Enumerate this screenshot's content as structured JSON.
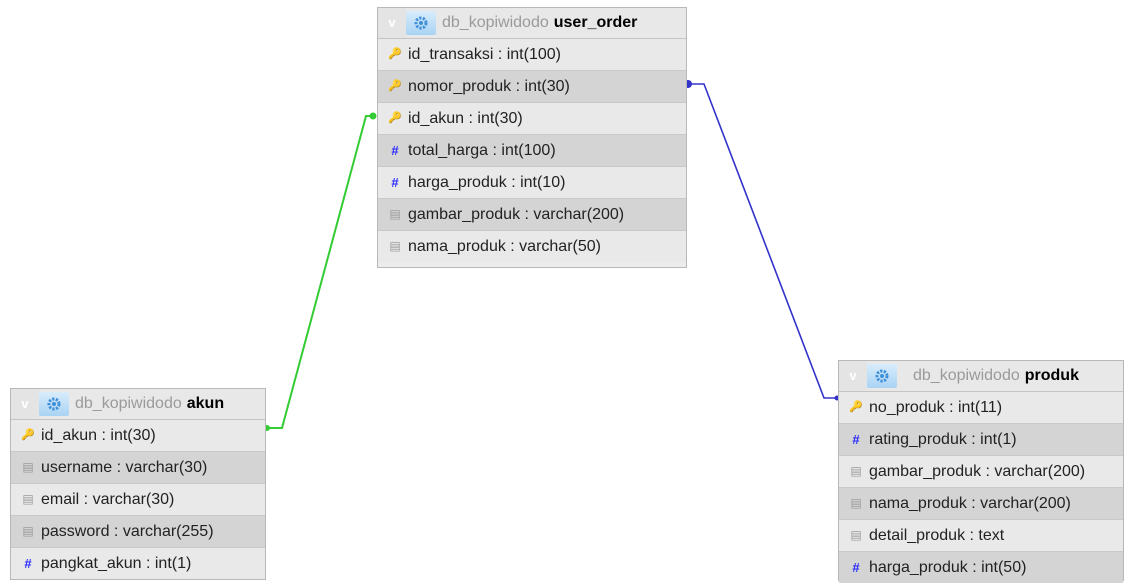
{
  "colors": {
    "link_user_order_akun": "#33cc33",
    "link_user_order_produk": "#3333cc",
    "header_gear": "#6aaee8"
  },
  "tables": {
    "user_order": {
      "toggle": "v",
      "db": "db_kopiwidodo",
      "name": "user_order",
      "fields": [
        {
          "text": "id_transaksi : int(100)",
          "icon": "key-icon"
        },
        {
          "text": "nomor_produk : int(30)",
          "icon": "key-icon"
        },
        {
          "text": "id_akun : int(30)",
          "icon": "key-icon"
        },
        {
          "text": "total_harga : int(100)",
          "icon": "number-icon"
        },
        {
          "text": "harga_produk : int(10)",
          "icon": "number-icon"
        },
        {
          "text": "gambar_produk : varchar(200)",
          "icon": "text-field-icon"
        },
        {
          "text": "nama_produk : varchar(50)",
          "icon": "text-field-icon"
        }
      ]
    },
    "akun": {
      "toggle": "v",
      "db": "db_kopiwidodo",
      "name": "akun",
      "fields": [
        {
          "text": "id_akun : int(30)",
          "icon": "key-icon"
        },
        {
          "text": "username : varchar(30)",
          "icon": "text-field-icon"
        },
        {
          "text": "email : varchar(30)",
          "icon": "text-field-icon"
        },
        {
          "text": "password : varchar(255)",
          "icon": "text-field-icon"
        },
        {
          "text": "pangkat_akun : int(1)",
          "icon": "number-icon"
        }
      ]
    },
    "produk": {
      "toggle": "v",
      "db": "db_kopiwidodo",
      "name": "produk",
      "fields": [
        {
          "text": "no_produk : int(11)",
          "icon": "key-icon"
        },
        {
          "text": "rating_produk : int(1)",
          "icon": "number-icon"
        },
        {
          "text": "gambar_produk : varchar(200)",
          "icon": "text-field-icon"
        },
        {
          "text": "nama_produk : varchar(200)",
          "icon": "text-field-icon"
        },
        {
          "text": "detail_produk : text",
          "icon": "text-field-icon"
        },
        {
          "text": "harga_produk : int(50)",
          "icon": "number-icon"
        }
      ]
    }
  }
}
